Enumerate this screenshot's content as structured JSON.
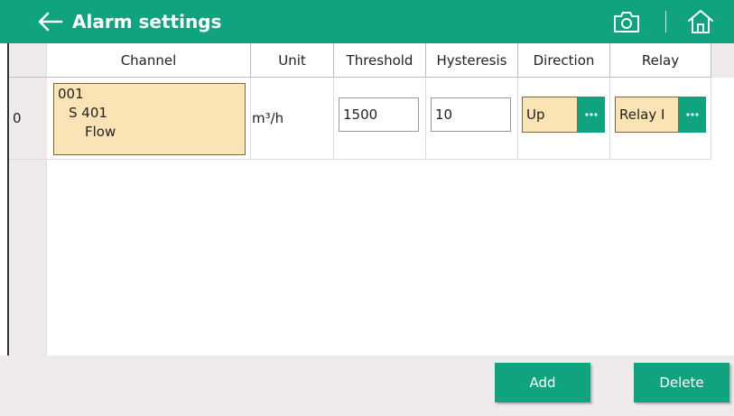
{
  "header": {
    "title": "Alarm settings",
    "back_icon": "arrow-left-icon",
    "camera_icon": "camera-icon",
    "home_icon": "home-icon"
  },
  "table": {
    "columns": [
      "Channel",
      "Unit",
      "Threshold",
      "Hysteresis",
      "Direction",
      "Relay"
    ],
    "rows": [
      {
        "index": "0",
        "channel": {
          "line1": "001",
          "line2": "S 401",
          "line3": "Flow"
        },
        "unit": "m³/h",
        "threshold": "1500",
        "hysteresis": "10",
        "direction": "Up",
        "relay": "Relay I"
      }
    ]
  },
  "footer": {
    "add_label": "Add",
    "delete_label": "Delete"
  },
  "colors": {
    "accent": "#0fa37f",
    "selection_fill": "#fae3b4",
    "panel_gray": "#eeebea"
  }
}
